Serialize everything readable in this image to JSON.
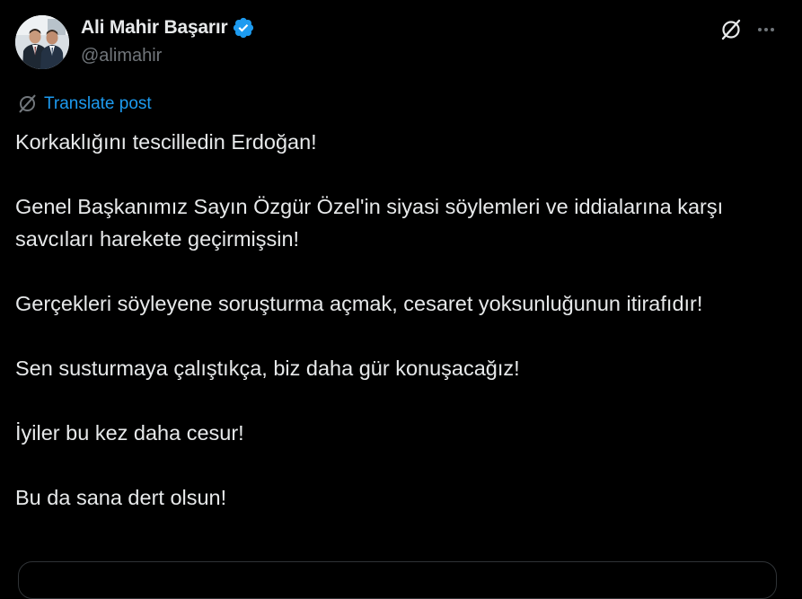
{
  "author": {
    "display_name": "Ali Mahir Başarır",
    "handle": "@alimahir",
    "verified": true,
    "verified_color": "#1d9bf0",
    "avatar_icon": "avatar-photo"
  },
  "actions": {
    "grok_icon": "grok-slash-icon",
    "more_icon": "more-horizontal-icon"
  },
  "translate": {
    "label": "Translate post",
    "icon": "grok-translate-icon"
  },
  "post": {
    "paragraphs": [
      "Korkaklığını tescilledin Erdoğan!",
      "Genel Başkanımız Sayın Özgür Özel'in siyasi söylemleri ve iddialarına karşı savcıları harekete geçirmişsin!",
      "Gerçekleri söyleyene soruşturma açmak, cesaret yoksunluğunun itirafıdır!",
      "Sen susturmaya çalıştıkça, biz daha gür konuşacağız!",
      "İyiler bu kez daha cesur!",
      "Bu da sana dert olsun!"
    ]
  },
  "colors": {
    "background": "#000000",
    "text_primary": "#e7e9ea",
    "text_secondary": "#71767b",
    "accent": "#1d9bf0",
    "border": "#2f3336"
  }
}
